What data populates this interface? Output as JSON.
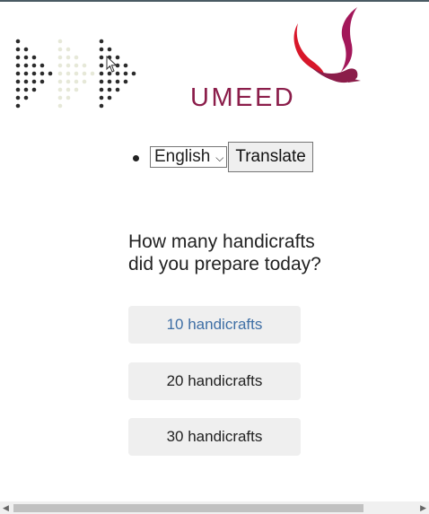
{
  "header": {
    "logo_text": "UMEED"
  },
  "language": {
    "selected": "English",
    "translate_label": "Translate"
  },
  "question": {
    "text": "How many handicrafts did you prepare today?"
  },
  "options": [
    {
      "label": "10 handicrafts"
    },
    {
      "label": "20 handicrafts"
    },
    {
      "label": "30 handicrafts"
    }
  ],
  "colors": {
    "brand": "#8b1d4a",
    "selected_text": "#3f6fa5",
    "option_bg": "#efefef"
  }
}
